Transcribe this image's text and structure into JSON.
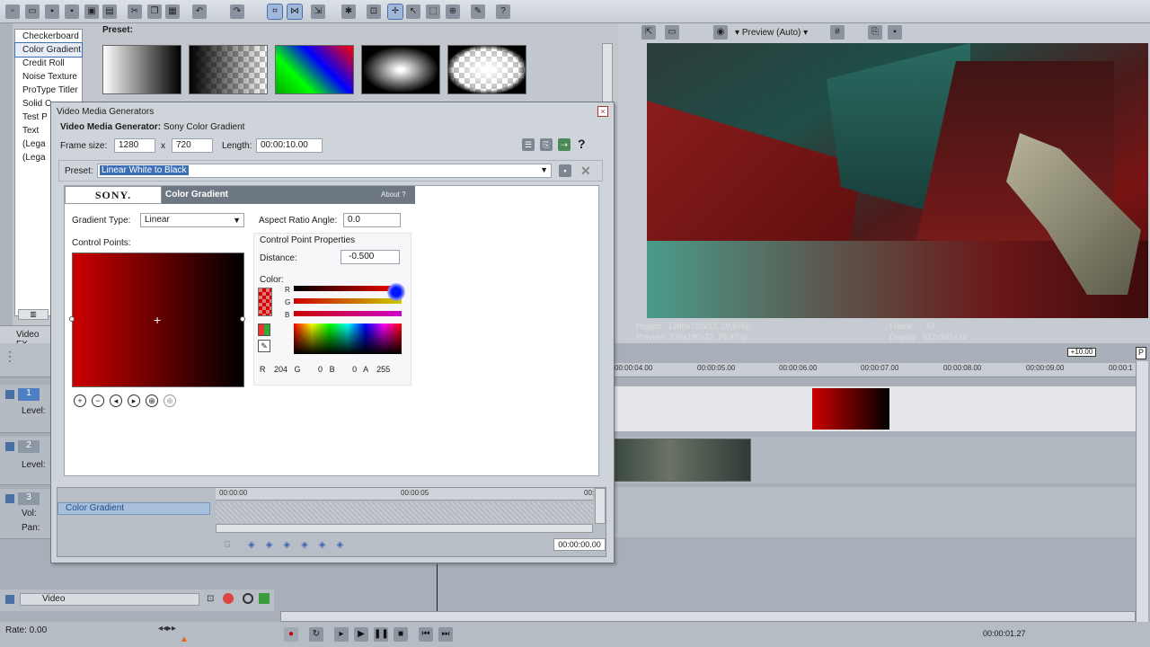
{
  "generators": {
    "preset_label": "Preset:",
    "items": [
      "Checkerboard",
      "Color Gradient",
      "Credit Roll",
      "Noise Texture",
      "ProType Titler",
      "Solid C",
      "Test P",
      "Text",
      "(Lega",
      "(Lega"
    ]
  },
  "video_fx_tab": "Video FX",
  "dialog": {
    "title": "Video Media Generators",
    "subtitle_bold": "Video Media Generator:",
    "subtitle_rest": " Sony Color Gradient",
    "frame_size_label": "Frame size:",
    "frame_w": "1280",
    "x_sep": "x",
    "frame_h": "720",
    "length_label": "Length:",
    "length_value": "00:00:10.00",
    "preset_label": "Preset:",
    "preset_value": "Linear White to Black",
    "sony_logo": "SONY.",
    "plugin_name": "Color Gradient",
    "about": "About",
    "about_q": "?",
    "gradient_type_label": "Gradient Type:",
    "gradient_type_value": "Linear",
    "aspect_label": "Aspect Ratio Angle:",
    "aspect_value": "0.0",
    "control_points_label": "Control Points:",
    "cp_props_label": "Control Point Properties",
    "distance_label": "Distance:",
    "distance_value": "-0.500",
    "color_label": "Color:",
    "ch_r": "R",
    "ch_g": "G",
    "ch_b": "B",
    "rgba": {
      "r_label": "R",
      "r": "204",
      "g_label": "G",
      "g": "0",
      "b_label": "B",
      "b": "0",
      "a_label": "A",
      "a": "255"
    },
    "timeline_start": "00:00:00",
    "timeline_mid": "00:00:05",
    "timeline_end": "00:",
    "track_label": "Color Gradient",
    "time_value": "00:00:00.00"
  },
  "preview": {
    "label": "Preview (Auto)",
    "project_label": "Project:",
    "project_value": "1280x720x32, 29.970p",
    "preview_label": "Preview:",
    "preview_value": "320x180x32, 29.970p",
    "frame_label": "Frame:",
    "frame_value": "57",
    "display_label": "Display:",
    "display_value": "612x345x32"
  },
  "timeline": {
    "marker": "+10.00",
    "ticks": [
      "00:00:04.00",
      "00:00:05.00",
      "00:00:06.00",
      "00:00:07.00",
      "00:00:08.00",
      "00:00:09.00",
      "00:00:1"
    ],
    "tracks": [
      {
        "num": "1",
        "level_label": "Level:"
      },
      {
        "num": "2",
        "level_label": "Level:"
      },
      {
        "num": "3",
        "vol_label": "Vol:",
        "pan_label": "Pan:"
      }
    ],
    "bus_label": "Video",
    "rate_label": "Rate: 0.00",
    "timecode": "00:00:01.27"
  },
  "colors": {
    "gradient_start": "#cc0000",
    "gradient_end": "#000000",
    "selection": "#3d6fb6"
  }
}
